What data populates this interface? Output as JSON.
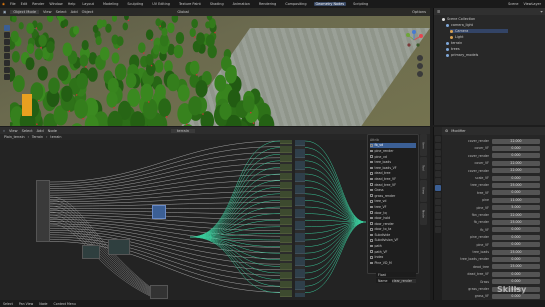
{
  "app": {
    "menus": [
      "File",
      "Edit",
      "Render",
      "Window",
      "Help"
    ],
    "workspaces": [
      "Layout",
      "Modeling",
      "Sculpting",
      "UV Editing",
      "Texture Paint",
      "Shading",
      "Animation",
      "Rendering",
      "Compositing",
      "Geometry Nodes",
      "Scripting"
    ],
    "active_workspace": "Geometry Nodes",
    "scene": "Scene",
    "view_layer": "ViewLayer"
  },
  "viewport": {
    "mode": "Object Mode",
    "menus": [
      "View",
      "Select",
      "Add",
      "Object"
    ],
    "orientation": "Global",
    "options_label": "Options"
  },
  "outliner": {
    "header": "Scene Collection",
    "items": [
      {
        "label": "Scene Collection",
        "color": "#dddddd"
      },
      {
        "label": "camera_light",
        "color": "#7ea7d8"
      },
      {
        "label": "Camera",
        "color": "#d8a050"
      },
      {
        "label": "Light",
        "color": "#d8a050"
      },
      {
        "label": "terrain",
        "color": "#7ea7d8"
      },
      {
        "label": "trees",
        "color": "#7ea7d8"
      },
      {
        "label": "primary_models",
        "color": "#7ea7d8"
      }
    ]
  },
  "node_editor": {
    "menus": [
      "View",
      "Select",
      "Add",
      "Node"
    ],
    "node_tree": "terrain",
    "breadcrumb": [
      "Plain_terrain",
      "Terrain",
      "terrain"
    ],
    "popup_title": "Attrib",
    "popup_items": [
      "fb_vd",
      "pine_render",
      "pine_vd",
      "tree_loads",
      "tree_loads_VF",
      "dead_tree",
      "dead_tree_VF",
      "dead_tree_VF",
      "Grass",
      "grass_render",
      "tree_vd",
      "tree_VF",
      "door_tq",
      "door_hold",
      "door_render",
      "door_to_ta",
      "Subdivide",
      "Subdivision_VF",
      "path",
      "path_VF",
      "Index",
      "Pine_VD_M"
    ],
    "popup_highlight_index": 0,
    "popup_fields": [
      {
        "label": "Float"
      },
      {
        "label": "Name",
        "value": "clear_render"
      }
    ]
  },
  "properties": {
    "header": "Modifier",
    "side_tabs": [
      "Item",
      "Tool",
      "View",
      "Node"
    ],
    "rows": [
      {
        "label": "cover_render",
        "value": "22.000"
      },
      {
        "label": "cover_VF",
        "value": "0.000"
      },
      {
        "label": "cover_render",
        "value": "0.000"
      },
      {
        "label": "cover_VF",
        "value": "22.000"
      },
      {
        "label": "cover_render",
        "value": "22.000"
      },
      {
        "label": "scale_VF",
        "value": "0.000"
      },
      {
        "label": "tree_render",
        "value": "25.000"
      },
      {
        "label": "tree_VF",
        "value": "0.000"
      },
      {
        "label": "pine",
        "value": "11.000"
      },
      {
        "label": "pine_VF",
        "value": "5.000"
      },
      {
        "label": "fbn_render",
        "value": "22.000"
      },
      {
        "label": "fb_render",
        "value": "25.000"
      },
      {
        "label": "fb_VF",
        "value": "0.000"
      },
      {
        "label": "pine_render",
        "value": "0.000"
      },
      {
        "label": "pine_VF",
        "value": "0.000"
      },
      {
        "label": "tree_loads",
        "value": "25.000"
      },
      {
        "label": "tree_loads_render",
        "value": "0.000"
      },
      {
        "label": "dead_tree",
        "value": "25.000"
      },
      {
        "label": "dead_tree_VF",
        "value": "0.000"
      },
      {
        "label": "Grass",
        "value": "0.000"
      },
      {
        "label": "grass_render",
        "value": "0.000"
      },
      {
        "label": "grass_VF",
        "value": "0.000"
      }
    ]
  },
  "statusbar": [
    "Select",
    "Pan View",
    "Node",
    "Context Menu"
  ],
  "watermark": "Skillsy"
}
